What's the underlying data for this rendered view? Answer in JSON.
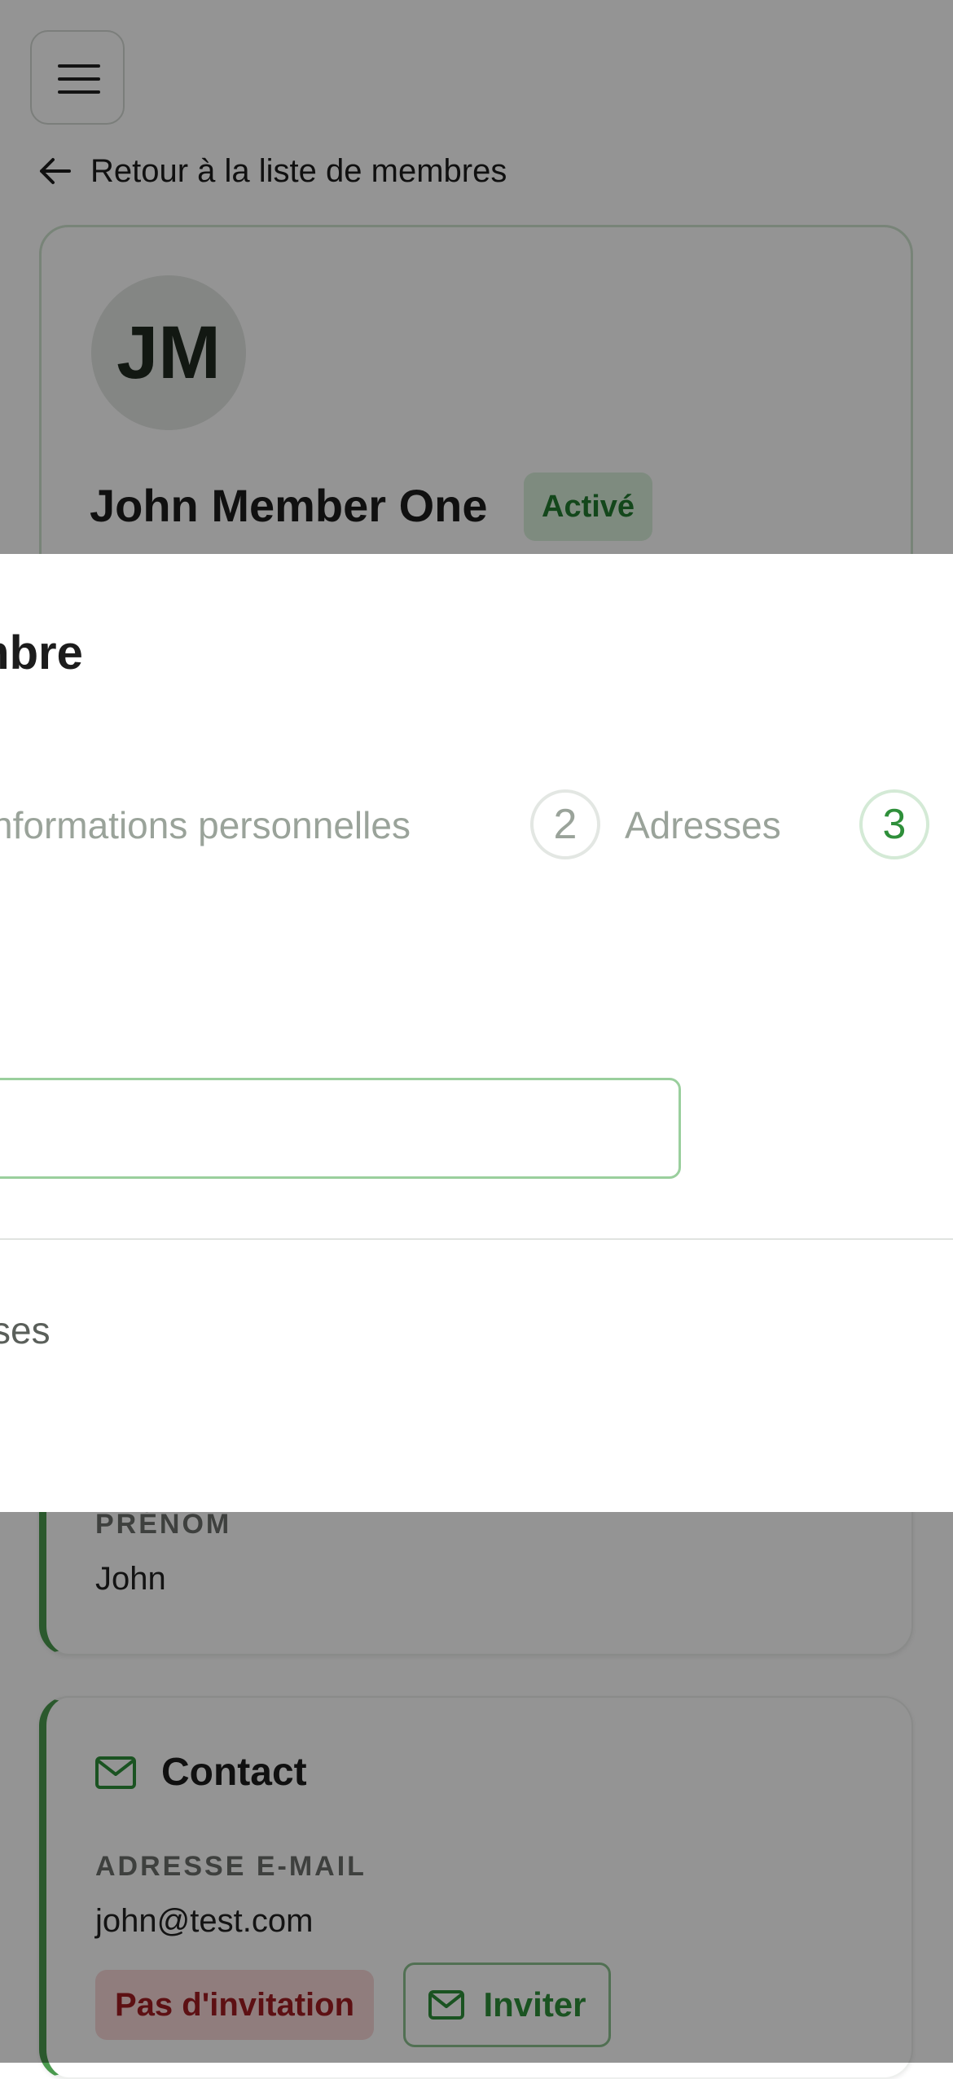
{
  "header": {
    "menu_icon": "hamburger-icon",
    "back_label": "Retour à la liste de membres"
  },
  "profile": {
    "initials": "JM",
    "name": "John Member One",
    "status": "Activé"
  },
  "identity": {
    "first_name_label": "PRÉNOM",
    "first_name_value": "John"
  },
  "contact": {
    "title": "Contact",
    "email_label": "ADRESSE E-MAIL",
    "email_value": "john@test.com",
    "invitation_status": "Pas d'invitation",
    "invite_label": "Inviter"
  },
  "modal": {
    "title": "mbre",
    "steps": [
      {
        "number": "",
        "label": "nformations personnelles"
      },
      {
        "number": "2",
        "label": "Adresses"
      },
      {
        "number": "3",
        "label": ""
      }
    ],
    "previous_step_text": "ses"
  },
  "colors": {
    "accent": "#2e8f3a",
    "status_bg": "#d9efdb",
    "danger": "#a11d22",
    "danger_bg": "#f8d7d8"
  }
}
